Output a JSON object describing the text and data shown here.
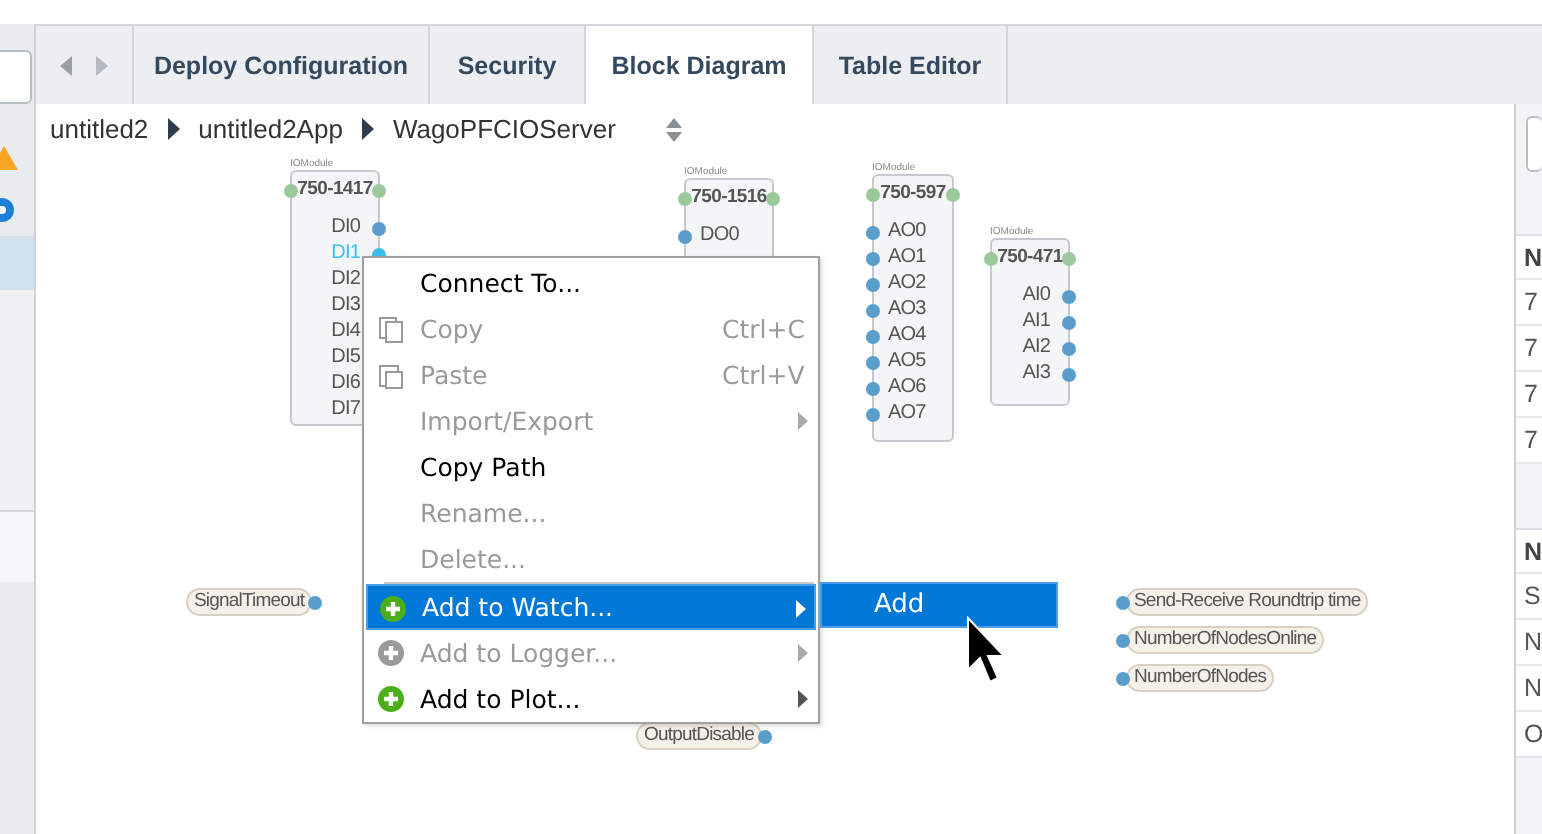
{
  "tabs": [
    {
      "label": "Deploy Configuration",
      "selected": false
    },
    {
      "label": "Security",
      "selected": false
    },
    {
      "label": "Block Diagram",
      "selected": true
    },
    {
      "label": "Table Editor",
      "selected": false
    }
  ],
  "breadcrumb": [
    "untitled2",
    "untitled2App",
    "WagoPFCIOServer"
  ],
  "modules": [
    {
      "type": "IOModule",
      "title": "750-1417",
      "ports": [
        {
          "label": "DI0",
          "kind": "input",
          "selected": false
        },
        {
          "label": "DI1",
          "kind": "input",
          "selected": true
        },
        {
          "label": "DI2",
          "kind": "input",
          "selected": false
        },
        {
          "label": "DI3",
          "kind": "input",
          "selected": false
        },
        {
          "label": "DI4",
          "kind": "input",
          "selected": false
        },
        {
          "label": "DI5",
          "kind": "input",
          "selected": false
        },
        {
          "label": "DI6",
          "kind": "input",
          "selected": false
        },
        {
          "label": "DI7",
          "kind": "input",
          "selected": false
        }
      ]
    },
    {
      "type": "IOModule",
      "title": "750-1516",
      "ports": [
        {
          "label": "DO0",
          "kind": "output",
          "selected": false
        }
      ]
    },
    {
      "type": "IOModule",
      "title": "750-597",
      "ports": [
        {
          "label": "AO0",
          "kind": "output",
          "selected": false
        },
        {
          "label": "AO1",
          "kind": "output",
          "selected": false
        },
        {
          "label": "AO2",
          "kind": "output",
          "selected": false
        },
        {
          "label": "AO3",
          "kind": "output",
          "selected": false
        },
        {
          "label": "AO4",
          "kind": "output",
          "selected": false
        },
        {
          "label": "AO5",
          "kind": "output",
          "selected": false
        },
        {
          "label": "AO6",
          "kind": "output",
          "selected": false
        },
        {
          "label": "AO7",
          "kind": "output",
          "selected": false
        }
      ]
    },
    {
      "type": "IOModule",
      "title": "750-471",
      "ports": [
        {
          "label": "AI0",
          "kind": "input",
          "selected": false
        },
        {
          "label": "AI1",
          "kind": "input",
          "selected": false
        },
        {
          "label": "AI2",
          "kind": "input",
          "selected": false
        },
        {
          "label": "AI3",
          "kind": "input",
          "selected": false
        }
      ]
    }
  ],
  "tags": [
    {
      "label": "SignalTimeout",
      "kind": "input"
    },
    {
      "label": "OutputDisable",
      "kind": "input"
    },
    {
      "label": "Send-Receive Roundtrip time",
      "kind": "output"
    },
    {
      "label": "NumberOfNodesOnline",
      "kind": "output"
    },
    {
      "label": "NumberOfNodes",
      "kind": "output"
    }
  ],
  "context_menu": {
    "items": [
      {
        "kind": "plain",
        "label": "Connect To...",
        "disabled": false,
        "selected": false,
        "submenu": false
      },
      {
        "kind": "copy",
        "label": "Copy",
        "shortcut": "Ctrl+C",
        "disabled": true,
        "selected": false,
        "submenu": false
      },
      {
        "kind": "paste",
        "label": "Paste",
        "shortcut": "Ctrl+V",
        "disabled": true,
        "selected": false,
        "submenu": false
      },
      {
        "kind": "plain",
        "label": "Import/Export",
        "disabled": true,
        "selected": false,
        "submenu": true
      },
      {
        "kind": "plain",
        "label": "Copy Path",
        "disabled": false,
        "selected": false,
        "submenu": false
      },
      {
        "kind": "plain",
        "label": "Rename...",
        "disabled": true,
        "selected": false,
        "submenu": false
      },
      {
        "kind": "plain",
        "label": "Delete...",
        "disabled": true,
        "selected": false,
        "submenu": false
      },
      {
        "kind": "separator"
      },
      {
        "kind": "add",
        "label": "Add to Watch...",
        "disabled": false,
        "selected": true,
        "submenu": true
      },
      {
        "kind": "add",
        "label": "Add to Logger...",
        "disabled": true,
        "selected": false,
        "submenu": true
      },
      {
        "kind": "add",
        "label": "Add to Plot...",
        "disabled": false,
        "selected": false,
        "submenu": true
      }
    ],
    "submenu": [
      {
        "label": "Add",
        "selected": true
      }
    ]
  },
  "right_panel": {
    "tables": [
      {
        "header": "N",
        "rows": [
          "7",
          "7",
          "7",
          "7"
        ]
      },
      {
        "header": "N",
        "rows": [
          "S",
          "N",
          "N",
          "O"
        ]
      }
    ]
  }
}
